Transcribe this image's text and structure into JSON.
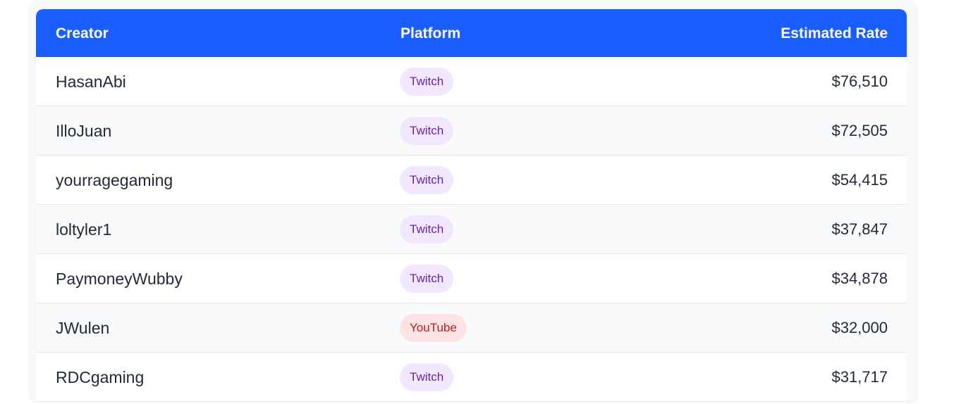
{
  "table": {
    "headers": {
      "creator": "Creator",
      "platform": "Platform",
      "rate": "Estimated Rate"
    },
    "rows": [
      {
        "creator": "HasanAbi",
        "platform": "Twitch",
        "rate": "$76,510"
      },
      {
        "creator": "IlloJuan",
        "platform": "Twitch",
        "rate": "$72,505"
      },
      {
        "creator": "yourragegaming",
        "platform": "Twitch",
        "rate": "$54,415"
      },
      {
        "creator": "loltyler1",
        "platform": "Twitch",
        "rate": "$37,847"
      },
      {
        "creator": "PaymoneyWubby",
        "platform": "Twitch",
        "rate": "$34,878"
      },
      {
        "creator": "JWulen",
        "platform": "YouTube",
        "rate": "$32,000"
      },
      {
        "creator": "RDCgaming",
        "platform": "Twitch",
        "rate": "$31,717"
      }
    ]
  },
  "colors": {
    "header_bg": "#1a5eff",
    "twitch_badge_bg": "#f1e8ff",
    "twitch_badge_text": "#6b21a8",
    "youtube_badge_bg": "#fde3e3",
    "youtube_badge_text": "#b91c1c"
  }
}
